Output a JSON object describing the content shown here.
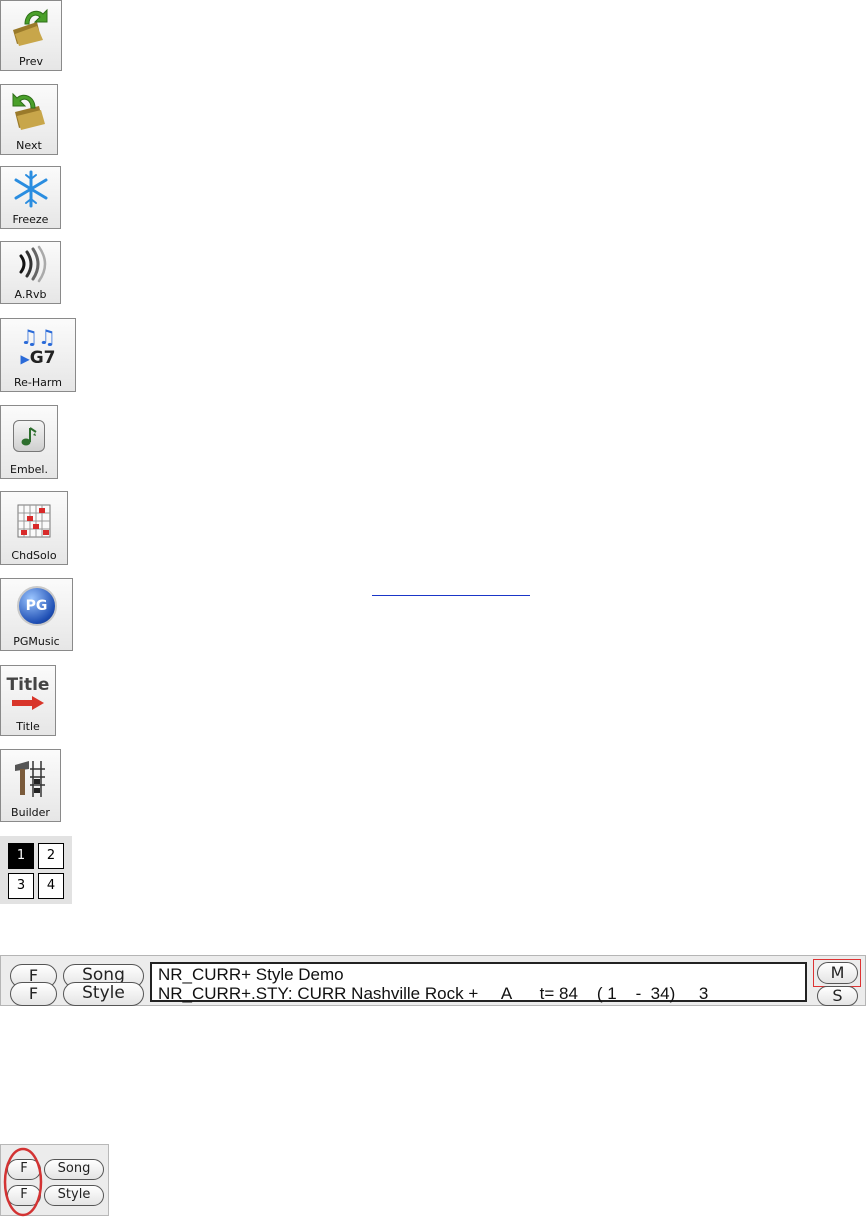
{
  "toolbar_buttons": [
    {
      "label": "Prev",
      "icon": "prev-folder-arrow-icon"
    },
    {
      "label": "Next",
      "icon": "next-folder-arrow-icon"
    },
    {
      "label": "Freeze",
      "icon": "snowflake-icon"
    },
    {
      "label": "A.Rvb",
      "icon": "reverb-waves-icon"
    },
    {
      "label": "Re-Harm",
      "icon": "reharm-notes-icon",
      "chord_text": "G7"
    },
    {
      "label": "Embel.",
      "icon": "embellish-note-icon"
    },
    {
      "label": "ChdSolo",
      "icon": "chord-solo-fretboard-icon"
    },
    {
      "label": "PGMusic",
      "icon": "pg-globe-icon",
      "logo_text": "PG"
    },
    {
      "label": "Title",
      "icon": "title-arrow-icon",
      "logo_text": "Title"
    },
    {
      "label": "Builder",
      "icon": "builder-hammer-icon"
    }
  ],
  "view_grid": {
    "cells": [
      "1",
      "2",
      "3",
      "4"
    ],
    "selected": "1"
  },
  "song_panel": {
    "f_label": "F",
    "song_label": "Song",
    "style_label": "Style",
    "m_label": "M",
    "s_label": "S",
    "song_title": "NR_CURR+ Style Demo",
    "style_line": "NR_CURR+.STY: CURR Nashville Rock +     A      t= 84    ( 1    -  34)     3"
  },
  "small_panel": {
    "f_label": "F",
    "song_label": "Song",
    "style_label": "Style"
  },
  "colors": {
    "highlight_red": "#d33333",
    "link_blue": "#1a36c8"
  }
}
